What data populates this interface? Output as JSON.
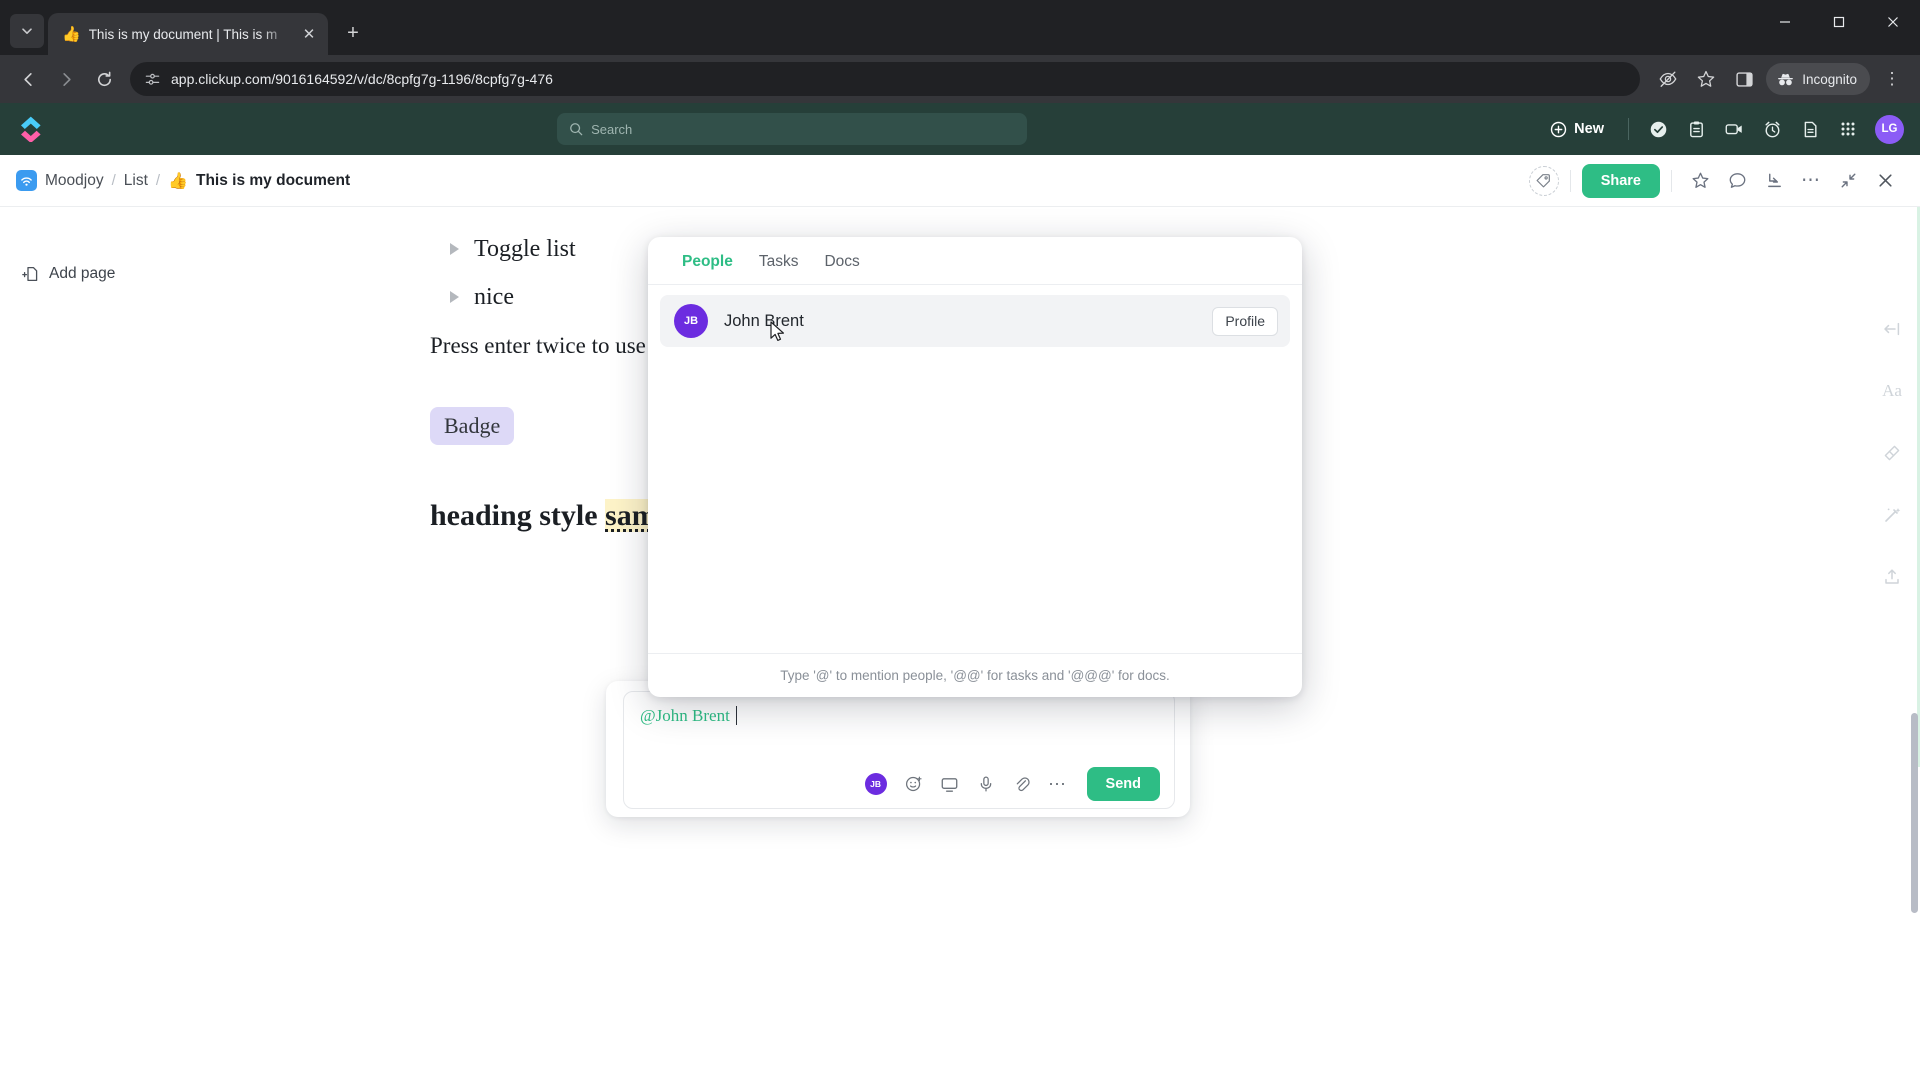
{
  "browser": {
    "tab": {
      "favicon": "thumbs-up",
      "title": "This is my document | This is m",
      "close_label": "✕"
    },
    "new_tab_label": "+",
    "tab_list_chevron": "⌄",
    "window_controls": {
      "minimize": "–",
      "maximize": "☐",
      "close": "✕"
    },
    "nav": {
      "back": "←",
      "forward": "→",
      "reload": "↻"
    },
    "omnibox": {
      "site_icon": "site-settings-icon",
      "url": "app.clickup.com/9016164592/v/dc/8cpfg7g-1196/8cpfg7g-476"
    },
    "actions": {
      "tracking_protection": "eye-off-icon",
      "bookmark": "star-icon",
      "side_panel": "side-panel-icon",
      "incognito_label": "Incognito",
      "menu": "⋮"
    }
  },
  "clickup": {
    "header": {
      "logo": "clickup-logo",
      "search_placeholder": "Search",
      "new_button": "New",
      "icons": [
        "check-circle-icon",
        "clipboard-icon",
        "video-icon",
        "alarm-clock-icon",
        "document-icon",
        "apps-grid-icon"
      ],
      "avatar_initials": "LG",
      "avatar_color": "#8b5cf6",
      "bg_color": "#263f39"
    },
    "doc_bar": {
      "breadcrumb": [
        {
          "label": "Moodjoy",
          "icon": "space-icon"
        },
        {
          "label": "List"
        },
        {
          "label": "This is my document",
          "emoji": "👍",
          "current": true
        }
      ],
      "separator": "/",
      "tag_icon": "tag-icon",
      "share_label": "Share",
      "share_color": "#2ebd85",
      "icons": [
        "star-icon",
        "comment-icon",
        "import-icon",
        "more-options-icon",
        "collapse-icon",
        "close-icon"
      ]
    },
    "sidebar": {
      "add_page_label": "Add page",
      "add_page_icon": "page-plus-icon"
    },
    "right_rail": [
      "collapse-left-icon",
      "text-style-icon",
      "relationships-icon",
      "magic-wand-icon",
      "export-icon"
    ],
    "document": {
      "toggles": [
        {
          "label": "Toggle list"
        },
        {
          "label": "nice"
        }
      ],
      "paragraph": "Press enter twice to use",
      "badge": "Badge",
      "heading_prefix": "heading style ",
      "heading_highlight": "sam"
    },
    "mention_panel": {
      "tabs": [
        {
          "label": "People",
          "active": true
        },
        {
          "label": "Tasks",
          "active": false
        },
        {
          "label": "Docs",
          "active": false
        }
      ],
      "active_color": "#2ebd85",
      "results": [
        {
          "initials": "JB",
          "avatar_color": "#6c2ce0",
          "name": "John Brent",
          "action_label": "Profile"
        }
      ],
      "hint": "Type '@' to mention people, '@@' for tasks and '@@@' for docs."
    },
    "composer": {
      "mention_text": "@John Brent",
      "mention_color": "#2ebd85",
      "avatar_initials": "JB",
      "tool_icons": [
        "emoji-icon",
        "screen-record-icon",
        "microphone-icon",
        "attachment-icon",
        "more-icon"
      ],
      "send_label": "Send",
      "send_color": "#2ebd85"
    }
  }
}
